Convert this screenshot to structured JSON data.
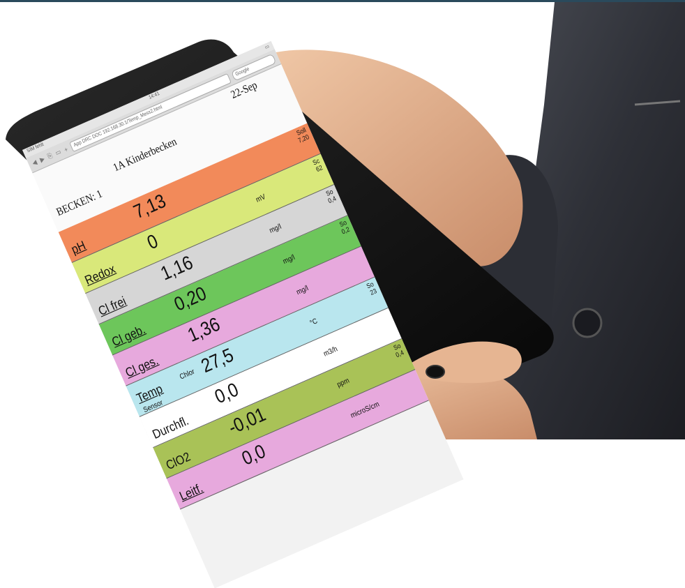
{
  "browser": {
    "carrier": "SIM fehlt",
    "time": "14:41",
    "page_title": "App DRC DOC",
    "url": "192.168.30.1/Temp_Mess2.html",
    "search_placeholder": "Google"
  },
  "header": {
    "basin": "BECKEN: 1",
    "pool": "1A Kinderbecken",
    "date": "22-Sep"
  },
  "rows": [
    {
      "label": "pH",
      "value": "7,13",
      "unit": "",
      "soll": "Soll",
      "soll_value": "7,20",
      "color": "#f28a5a"
    },
    {
      "label": "Redox",
      "value": "0",
      "unit": "mV",
      "soll": "Sc",
      "soll_value": "62",
      "color": "#d9e87a"
    },
    {
      "label": "Cl frei",
      "value": "1,16",
      "unit": "mg/l",
      "soll": "So",
      "soll_value": "0,4",
      "color": "#d6d6d6"
    },
    {
      "label": "Cl geb.",
      "value": "0,20",
      "unit": "mg/l",
      "soll": "So",
      "soll_value": "0,2",
      "color": "#6dc65b"
    },
    {
      "label": "Cl ges.",
      "value": "1,36",
      "unit": "mg/l",
      "soll": "",
      "soll_value": "",
      "color": "#e7a9dd"
    },
    {
      "label": "Temp",
      "sublabel": "Sensor",
      "sublabel2": "Chlor",
      "value": "27,5",
      "unit": "°C",
      "soll": "So",
      "soll_value": "23",
      "color": "#b9e6ee"
    },
    {
      "label": "Durchfl.",
      "value": "0,0",
      "unit": "m3/h",
      "soll": "",
      "soll_value": "",
      "color": "#ffffff"
    },
    {
      "label": "ClO2",
      "value": "-0,01",
      "unit": "ppm",
      "soll": "So",
      "soll_value": "0,4",
      "color": "#a9c257"
    },
    {
      "label": "Leitf.",
      "value": "0,0",
      "unit": "microS/cm",
      "soll": "",
      "soll_value": "",
      "color": "#e7a9dd"
    }
  ]
}
